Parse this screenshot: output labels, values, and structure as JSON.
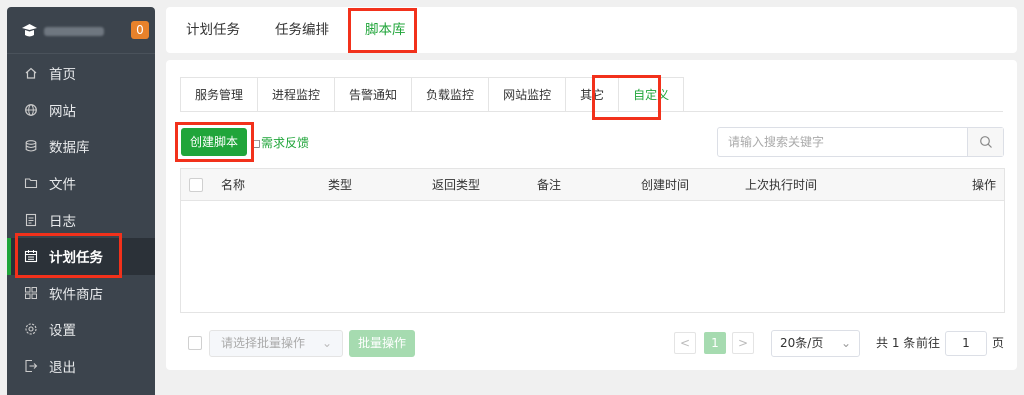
{
  "sidebar": {
    "badge": "0",
    "items": [
      {
        "label": "首页",
        "icon": "home-icon"
      },
      {
        "label": "网站",
        "icon": "globe-icon"
      },
      {
        "label": "数据库",
        "icon": "database-icon"
      },
      {
        "label": "文件",
        "icon": "folder-icon"
      },
      {
        "label": "日志",
        "icon": "log-icon"
      },
      {
        "label": "计划任务",
        "icon": "calendar-icon",
        "active": true
      },
      {
        "label": "软件商店",
        "icon": "grid-icon"
      },
      {
        "label": "设置",
        "icon": "gear-icon"
      },
      {
        "label": "退出",
        "icon": "logout-icon"
      }
    ]
  },
  "top_tabs": [
    "计划任务",
    "任务编排",
    "脚本库"
  ],
  "top_tab_active": "脚本库",
  "sub_tabs": [
    "服务管理",
    "进程监控",
    "告警通知",
    "负载监控",
    "网站监控",
    "其它",
    "自定义"
  ],
  "sub_tab_active": "自定义",
  "toolbar": {
    "create_label": "创建脚本",
    "feedback_label": "需求反馈",
    "search_placeholder": "请输入搜索关键字"
  },
  "table": {
    "columns": [
      "名称",
      "类型",
      "返回类型",
      "备注",
      "创建时间",
      "上次执行时间",
      "操作"
    ],
    "rows": []
  },
  "footer": {
    "batch_placeholder": "请选择批量操作",
    "batch_button": "批量操作",
    "prev": "<",
    "current_page": "1",
    "next": ">",
    "page_size": "20条/页",
    "total": "共 1 条",
    "goto_label": "前往",
    "goto_value": "1",
    "page_unit": "页"
  },
  "colors": {
    "accent": "#20a53a",
    "sidebar_bg": "#3c444d",
    "badge": "#e8822b",
    "highlight": "#f2311b"
  }
}
